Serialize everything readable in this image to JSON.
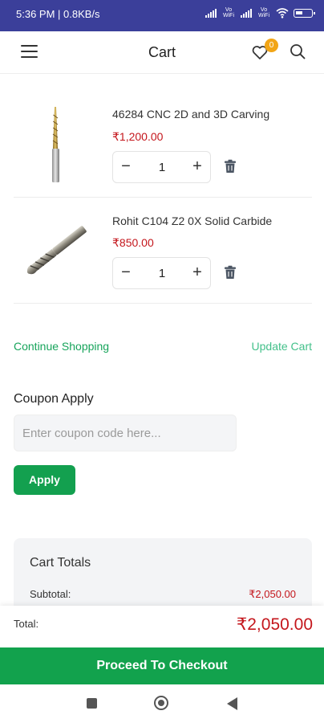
{
  "status_bar": {
    "time_speed": "5:36 PM | 0.8KB/s",
    "volte_label_1": "Vo WiFi",
    "volte_label_2": "Vo WiFi"
  },
  "header": {
    "title": "Cart",
    "wishlist_count": "0"
  },
  "cart": {
    "items": [
      {
        "name": "46284 CNC 2D and 3D Carving",
        "price": "₹1,200.00",
        "quantity": "1"
      },
      {
        "name": "Rohit C104 Z2 0X Solid Carbide",
        "price": "₹850.00",
        "quantity": "1"
      }
    ],
    "qty_minus": "−",
    "qty_plus": "+"
  },
  "links": {
    "continue": "Continue Shopping",
    "update": "Update Cart"
  },
  "coupon": {
    "title": "Coupon Apply",
    "placeholder": "Enter coupon code here...",
    "value": "",
    "apply_label": "Apply"
  },
  "totals": {
    "title": "Cart Totals",
    "subtotal_label": "Subtotal:",
    "subtotal_value": "₹2,050.00"
  },
  "bottom": {
    "total_label": "Total:",
    "total_value": "₹2,050.00",
    "checkout_label": "Proceed To Checkout"
  },
  "colors": {
    "accent_green": "#12a24d",
    "price_red": "#c4161c",
    "status_bar": "#3b3f9a",
    "badge": "#f2a516"
  },
  "icons": [
    "menu-icon",
    "heart-icon",
    "search-icon",
    "trash-icon",
    "wifi-icon",
    "battery-icon"
  ]
}
